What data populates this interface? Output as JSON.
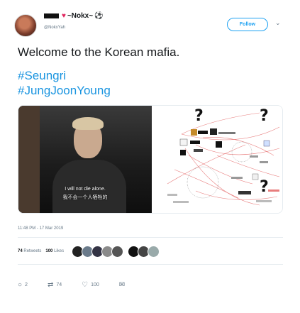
{
  "header": {
    "display_name": "~Nokx~",
    "handle": "@NokxYah",
    "follow_label": "Follow",
    "chevron": "⌄"
  },
  "tweet": {
    "text": "Welcome to the Korean mafia.",
    "hashtags": [
      "#Seungri",
      "#JungJoonYoung"
    ]
  },
  "media": {
    "subtitle_en": "I will not die alone.",
    "subtitle_zh": "我不会一个人牺牲的",
    "question_marks": [
      "?",
      "?",
      "?"
    ]
  },
  "meta": {
    "timestamp": "11:48 PM - 17 Mar 2019"
  },
  "stats": {
    "retweets_count": "74",
    "retweets_label": "Retweets",
    "likes_count": "100",
    "likes_label": "Likes"
  },
  "actions": {
    "reply_count": "2",
    "retweet_count": "74",
    "like_count": "100"
  },
  "colors": {
    "accent": "#1da1f2",
    "hashtag": "#1b95e0",
    "heart": "#e0245e"
  }
}
